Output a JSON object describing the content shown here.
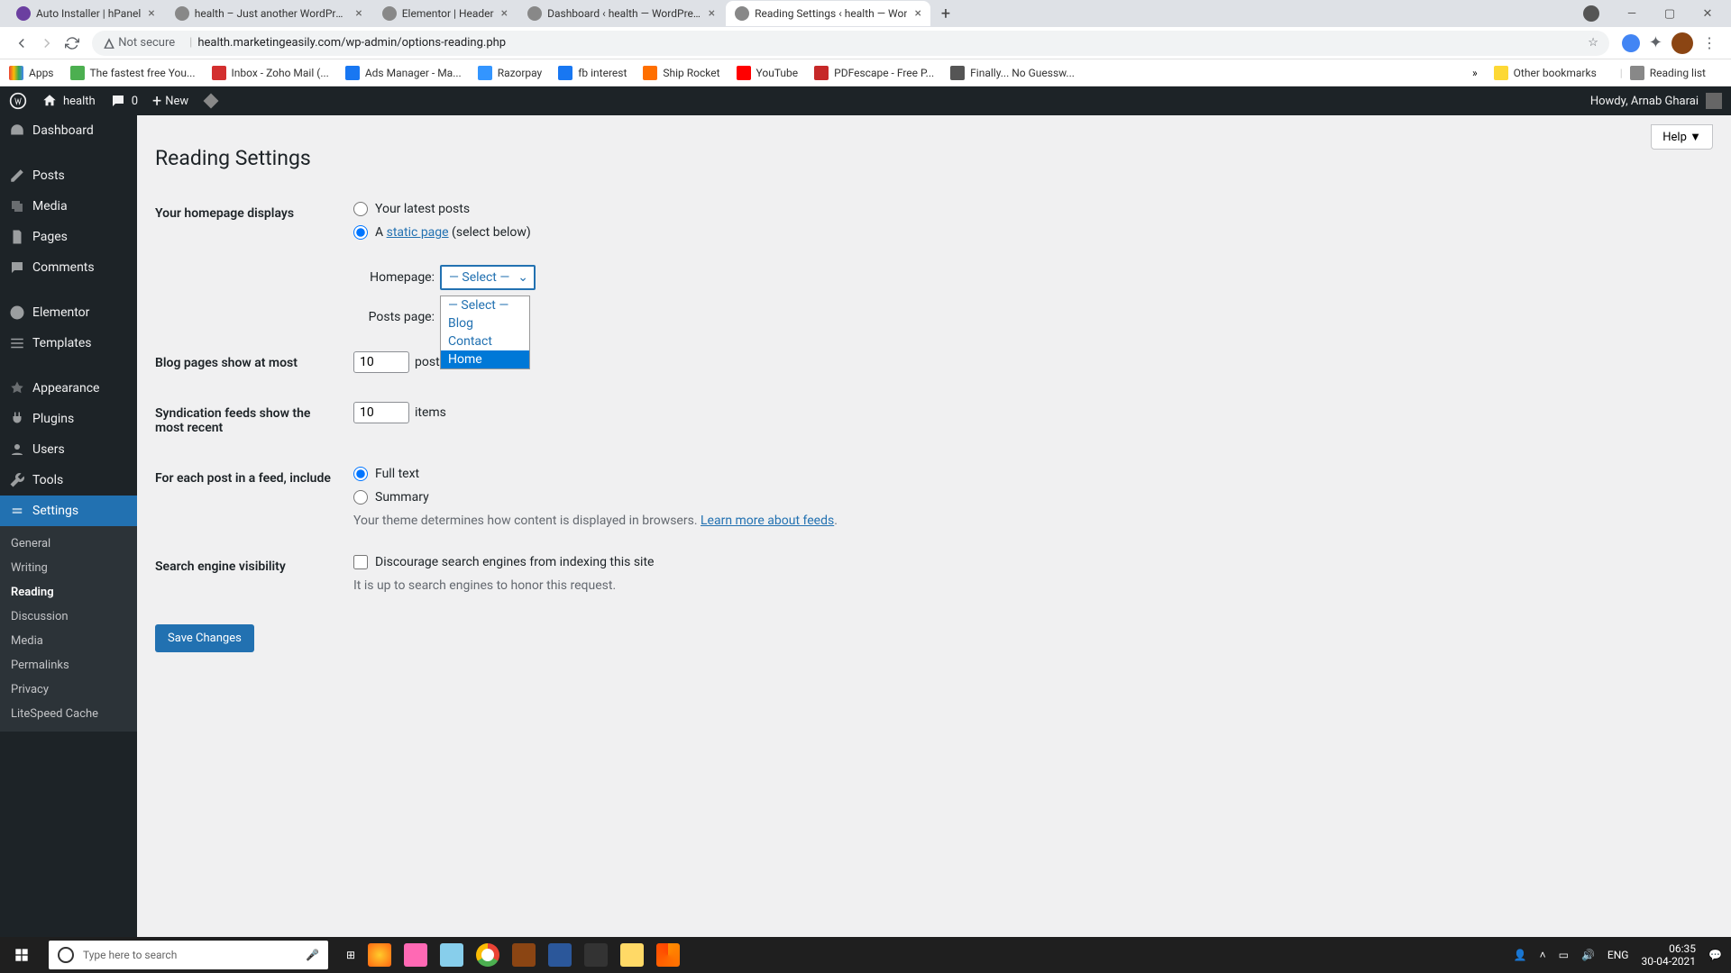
{
  "tabs": [
    {
      "title": "Auto Installer | hPanel"
    },
    {
      "title": "health – Just another WordPress"
    },
    {
      "title": "Elementor | Header"
    },
    {
      "title": "Dashboard ‹ health — WordPress"
    },
    {
      "title": "Reading Settings ‹ health — Wor"
    }
  ],
  "url": {
    "warn": "Not secure",
    "text": "health.marketingeasily.com/wp-admin/options-reading.php"
  },
  "bookmarks": [
    "Apps",
    "The fastest free You...",
    "Inbox - Zoho Mail (...",
    "Ads Manager - Ma...",
    "Razorpay",
    "fb interest",
    "Ship Rocket",
    "YouTube",
    "PDFescape - Free P...",
    "Finally... No Guessw..."
  ],
  "bm_right": {
    "other": "Other bookmarks",
    "reading": "Reading list"
  },
  "adminbar": {
    "site": "health",
    "comments": "0",
    "new": "New",
    "howdy": "Howdy, Arnab Gharai"
  },
  "sidebar": {
    "items": [
      "Dashboard",
      "Posts",
      "Media",
      "Pages",
      "Comments",
      "Elementor",
      "Templates",
      "Appearance",
      "Plugins",
      "Users",
      "Tools",
      "Settings"
    ],
    "sub": [
      "General",
      "Writing",
      "Reading",
      "Discussion",
      "Media",
      "Permalinks",
      "Privacy",
      "LiteSpeed Cache"
    ]
  },
  "page": {
    "help": "Help ▼",
    "title": "Reading Settings",
    "hp_label": "Your homepage displays",
    "latest": "Your latest posts",
    "static_pre": "A ",
    "static_link": "static page",
    "static_post": " (select below)",
    "homepage_lbl": "Homepage:",
    "posts_lbl": "Posts page:",
    "select_placeholder": "— Select —",
    "options": [
      "— Select —",
      "Blog",
      "Contact",
      "Home"
    ],
    "blog_pages_label": "Blog pages show at most",
    "blog_pages_val": "10",
    "blog_pages_after": "posts",
    "syndication_label": "Syndication feeds show the most recent",
    "syndication_val": "10",
    "syndication_after": "items",
    "feed_label": "For each post in a feed, include",
    "fulltext": "Full text",
    "summary": "Summary",
    "feed_desc": "Your theme determines how content is displayed in browsers. ",
    "feed_link": "Learn more about feeds",
    "feed_dot": ".",
    "seo_label": "Search engine visibility",
    "seo_check": "Discourage search engines from indexing this site",
    "seo_desc": "It is up to search engines to honor this request.",
    "save": "Save Changes"
  },
  "taskbar": {
    "search": "Type here to search",
    "lang": "ENG",
    "time": "06:35",
    "date": "30-04-2021"
  }
}
